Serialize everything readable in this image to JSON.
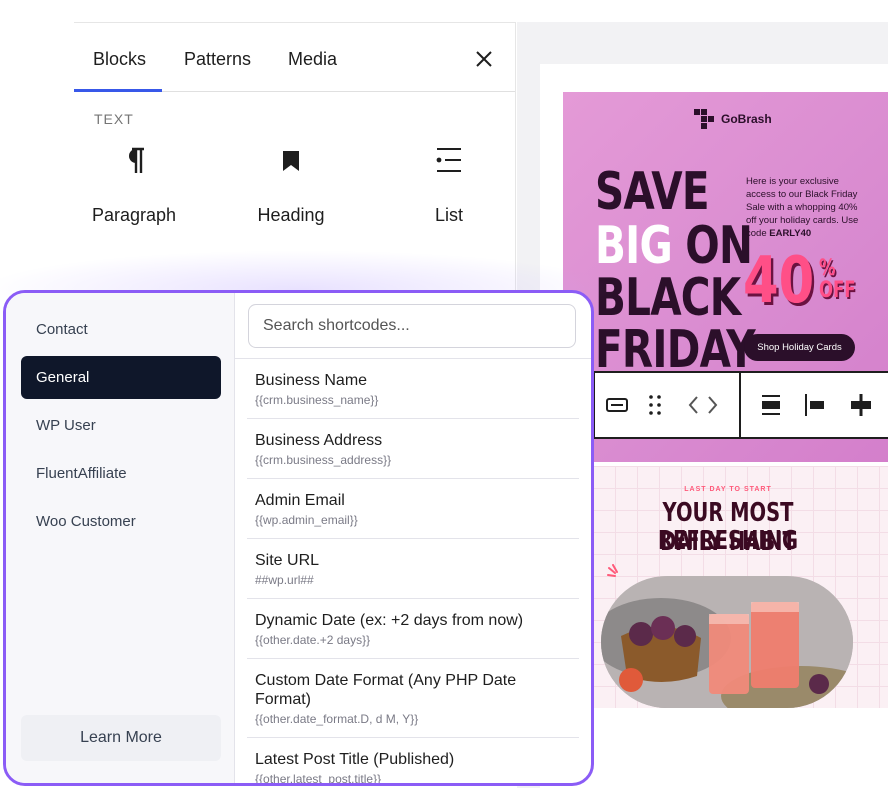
{
  "inserter": {
    "tabs": [
      "Blocks",
      "Patterns",
      "Media"
    ],
    "active_tab": "Blocks",
    "section_label": "TEXT",
    "blocks": [
      {
        "label": "Paragraph",
        "icon": "paragraph-icon"
      },
      {
        "label": "Heading",
        "icon": "bookmark-icon"
      },
      {
        "label": "List",
        "icon": "list-icon"
      }
    ]
  },
  "promo1": {
    "brand": "GoBrash",
    "words": {
      "save": "SAVE",
      "big": "BIG",
      "on": "ON",
      "black": "BLACK",
      "friday": "FRIDAY"
    },
    "desc": "Here is your exclusive access to our Black Friday Sale with a whopping 40% off your holiday cards. Use code",
    "code": "EARLY40",
    "percent": "40",
    "pct_symbol": "%",
    "off": "OFF",
    "cta": "Shop Holiday Cards"
  },
  "promo2": {
    "kicker": "LAST DAY TO START",
    "title_line1": "YOUR MOST REFRESHING",
    "title_line2": "DAILY HABIT"
  },
  "shortcodes": {
    "categories": [
      "Contact",
      "General",
      "WP User",
      "FluentAffiliate",
      "Woo Customer"
    ],
    "active_category": "General",
    "learn_more": "Learn More",
    "search_placeholder": "Search shortcodes...",
    "items": [
      {
        "title": "Business Name",
        "code": "{{crm.business_name}}"
      },
      {
        "title": "Business Address",
        "code": "{{crm.business_address}}"
      },
      {
        "title": "Admin Email",
        "code": "{{wp.admin_email}}"
      },
      {
        "title": "Site URL",
        "code": "##wp.url##"
      },
      {
        "title": "Dynamic Date (ex: +2 days from now)",
        "code": "{{other.date.+2 days}}"
      },
      {
        "title": "Custom Date Format (Any PHP Date Format)",
        "code": "{{other.date_format.D, d M, Y}}"
      },
      {
        "title": "Latest Post Title (Published)",
        "code": "{{other.latest_post.title}}"
      }
    ]
  },
  "colors": {
    "accent_purple": "#8b5cf6",
    "active_category_bg": "#0f172a",
    "tab_underline": "#3858e9",
    "promo_pink": "#e49ad7",
    "promo_hot": "#ff4f87"
  }
}
